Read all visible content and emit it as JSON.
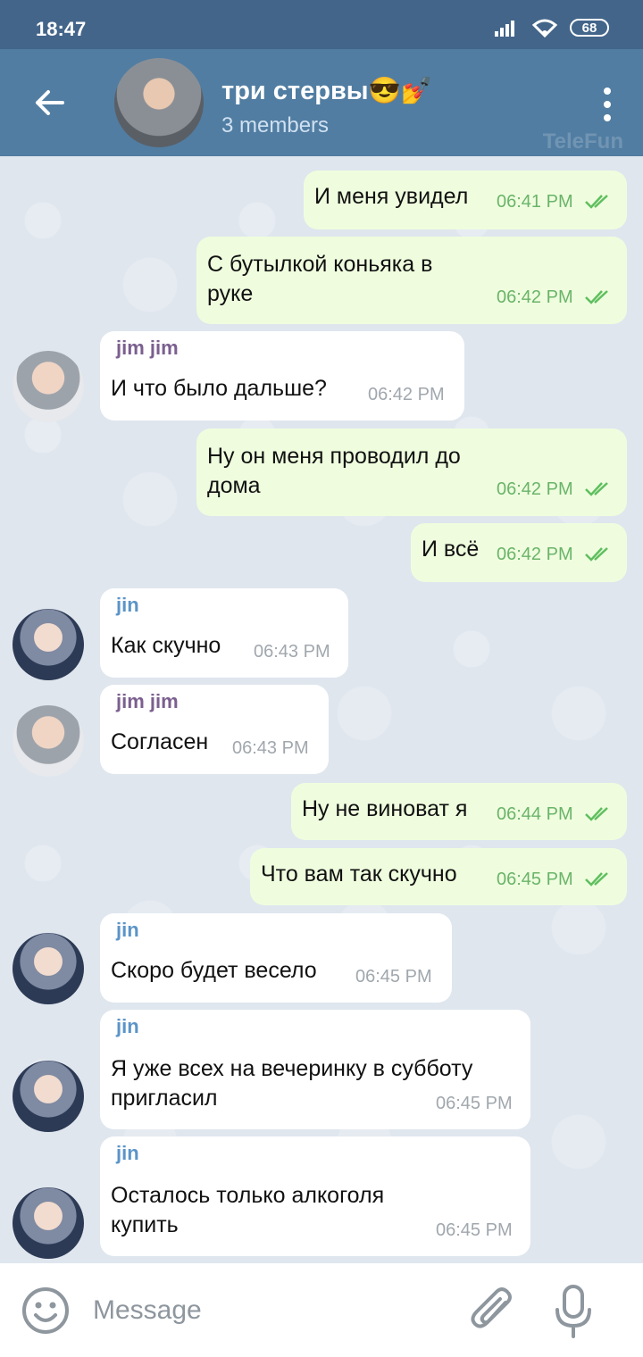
{
  "status": {
    "time": "18:47",
    "battery": "68"
  },
  "header": {
    "title": "три стервы😎💅",
    "subtitle": "3 members",
    "watermark": "TeleFun"
  },
  "messages": [
    {
      "dir": "out",
      "text": "И меня увидел",
      "time": "06:41 PM"
    },
    {
      "dir": "out",
      "text": "С бутылкой коньяка в\nруке",
      "time": "06:42 PM"
    },
    {
      "dir": "in",
      "sender": "jim jim",
      "text": "И что было дальше?",
      "time": "06:42 PM"
    },
    {
      "dir": "out",
      "text": "Ну он меня проводил до\nдома",
      "time": "06:42 PM"
    },
    {
      "dir": "out",
      "text": "И всё",
      "time": "06:42 PM"
    },
    {
      "dir": "in",
      "sender": "jin",
      "text": "Как скучно",
      "time": "06:43 PM"
    },
    {
      "dir": "in",
      "sender": "jim jim",
      "text": "Согласен",
      "time": "06:43 PM"
    },
    {
      "dir": "out",
      "text": "Ну не виноват я",
      "time": "06:44 PM"
    },
    {
      "dir": "out",
      "text": "Что вам так скучно",
      "time": "06:45 PM"
    },
    {
      "dir": "in",
      "sender": "jin",
      "text": "Скоро будет весело",
      "time": "06:45 PM"
    },
    {
      "dir": "in",
      "sender": "jin",
      "text": "Я уже всех на вечеринку в субботу\nпригласил",
      "time": "06:45 PM"
    },
    {
      "dir": "in",
      "sender": "jin",
      "text": "Осталось только алкоголя\nкупить",
      "time": "06:45 PM"
    }
  ],
  "senders": {
    "jim jim": {
      "color": "#7b5f8f"
    },
    "jin": {
      "color": "#5b94c8"
    }
  },
  "input": {
    "placeholder": "Message"
  },
  "colors": {
    "appbar": "#517da2",
    "statusbar": "#43658a",
    "outgoing_bubble": "#effdde",
    "incoming_bubble": "#ffffff",
    "check": "#5fbf5f"
  }
}
